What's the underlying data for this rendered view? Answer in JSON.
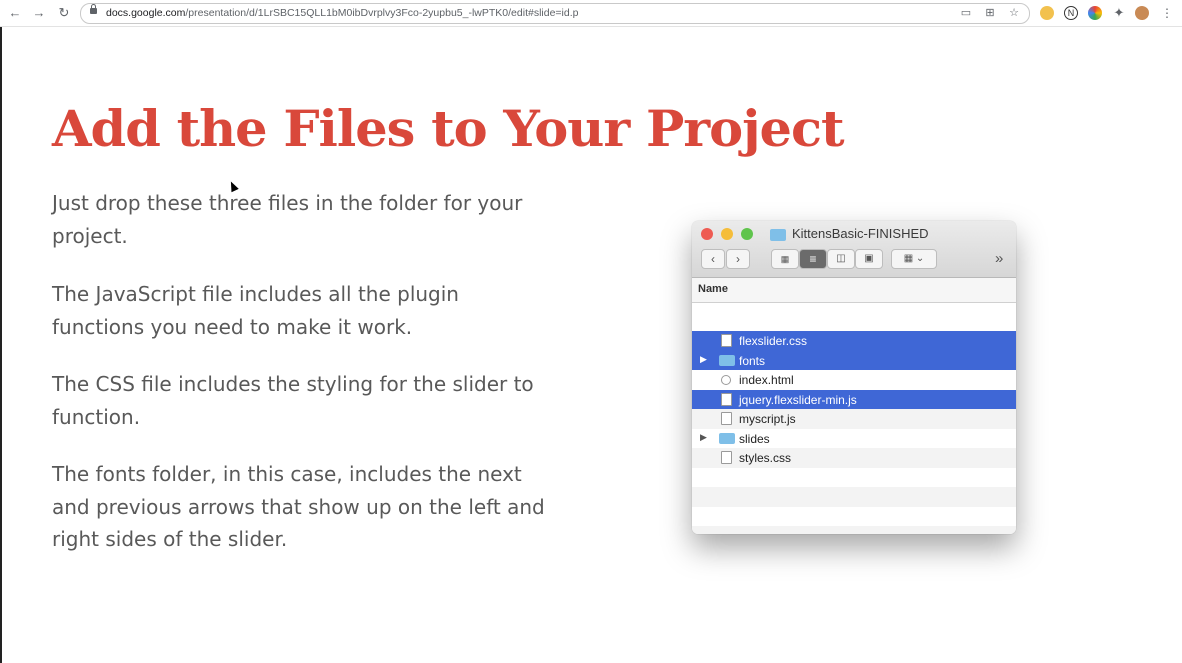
{
  "browser": {
    "back_icon": "arrow-left-icon",
    "forward_icon": "arrow-right-icon",
    "reload_icon": "reload-icon",
    "url_host": "docs.google.com",
    "url_path": "/presentation/d/1LrSBC15QLL1bM0ibDvrplvy3Fco-2yupbu5_-lwPTK0/edit#slide=id.p"
  },
  "slide": {
    "title": "Add the Files to Your Project",
    "paragraphs": [
      "Just drop these three files in the folder for your project.",
      "The JavaScript file includes all the plugin functions you need to make it work.",
      "The CSS file includes the styling for the slider to function.",
      "The fonts folder, in this case, includes the next and previous arrows that show up on the left and right sides of the slider."
    ]
  },
  "finder": {
    "title": "KittensBasic-FINISHED",
    "column_header": "Name",
    "more_label": "»",
    "files": [
      {
        "name": "flexslider.css",
        "kind": "file",
        "selected": true
      },
      {
        "name": "fonts",
        "kind": "folder",
        "selected": true
      },
      {
        "name": "index.html",
        "kind": "file",
        "selected": false
      },
      {
        "name": "jquery.flexslider-min.js",
        "kind": "file",
        "selected": true
      },
      {
        "name": "myscript.js",
        "kind": "file",
        "selected": false
      },
      {
        "name": "slides",
        "kind": "folder",
        "selected": false
      },
      {
        "name": "styles.css",
        "kind": "file",
        "selected": false
      }
    ]
  },
  "colors": {
    "title": "#d9483b",
    "body_text": "#595959",
    "selection": "#3f67d6"
  }
}
